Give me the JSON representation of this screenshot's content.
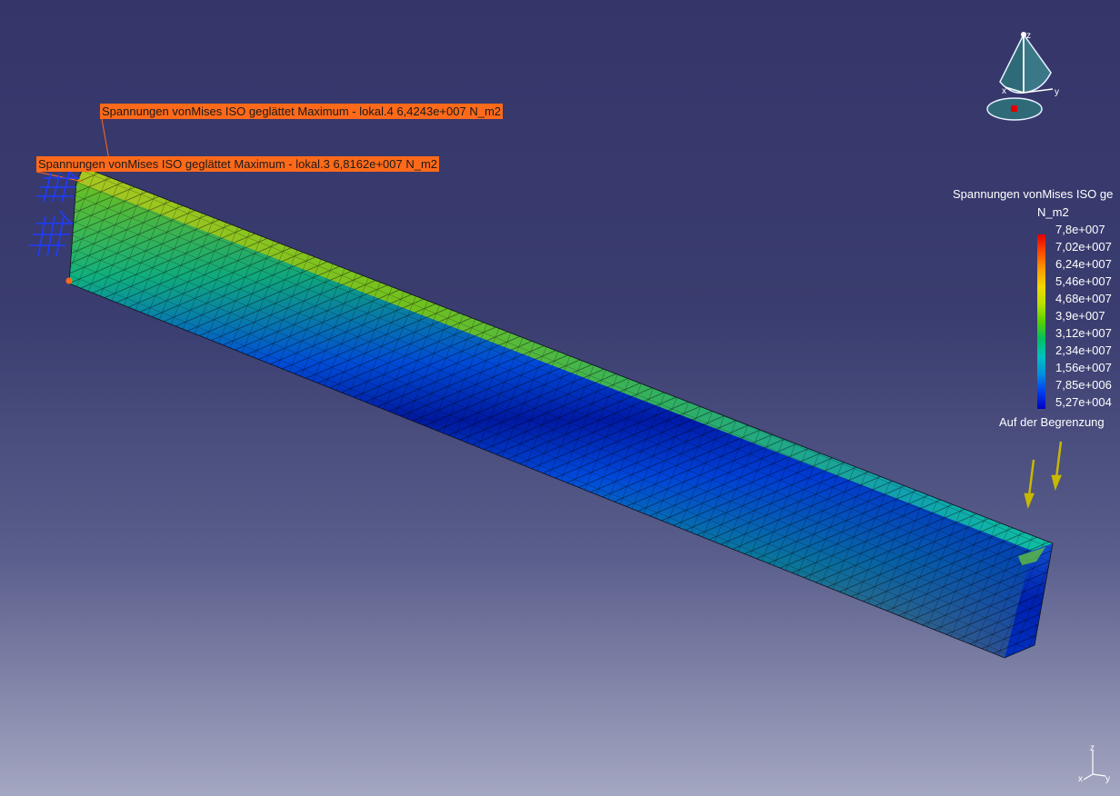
{
  "annotations": {
    "max_local_4": "Spannungen vonMises ISO geglättet  Maximum - lokal.4  6,4243e+007 N_m2",
    "max_local_3": "Spannungen vonMises ISO geglättet  Maximum - lokal.3  6,8162e+007 N_m2"
  },
  "legend": {
    "title": "Spannungen vonMises ISO ge",
    "unit": "N_m2",
    "ticks": [
      "7,8e+007",
      "7,02e+007",
      "6,24e+007",
      "5,46e+007",
      "4,68e+007",
      "3,9e+007",
      "3,12e+007",
      "2,34e+007",
      "1,56e+007",
      "7,85e+006",
      "5,27e+004"
    ],
    "footer": "Auf der Begrenzung"
  },
  "compass": {
    "z_label": "z",
    "x_label": "x",
    "y_label": "y"
  },
  "mini_axis": {
    "z_label": "z",
    "x_label": "x",
    "y_label": "y"
  },
  "colors": {
    "annotation_bg": "#ff6a1a",
    "constraint": "#1e3cff",
    "load_arrow": "#c8b800",
    "background_top": "#35356a",
    "background_bottom": "#a4a7c1"
  },
  "icons": [
    "clamp-constraint-icon",
    "load-arrow-icon",
    "compass-icon",
    "axis-triad-icon"
  ]
}
